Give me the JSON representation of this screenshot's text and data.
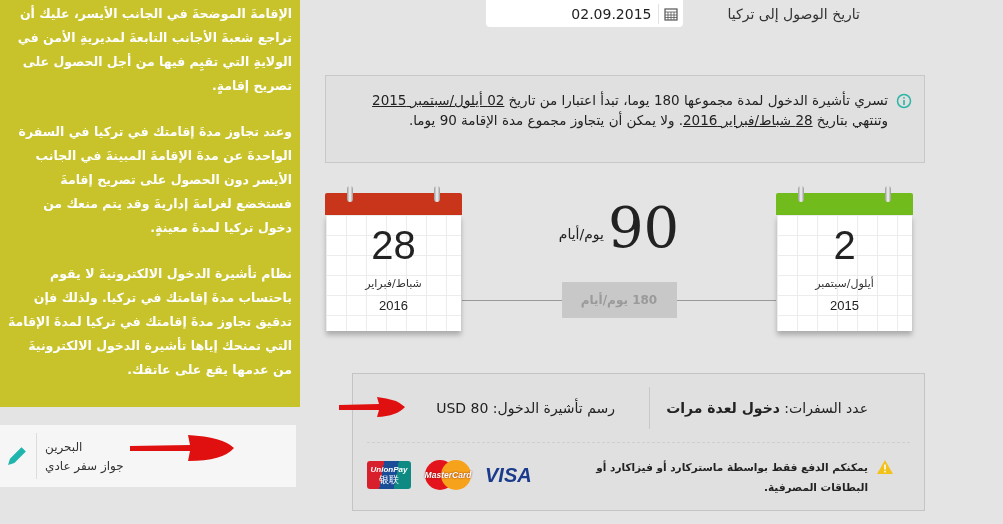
{
  "sidebar": {
    "paragraphs": [
      "الإقامةَ الموضحةَ في الجانب الأيسر، عليك أن تراجع شعبةَ الأجانب التابعةَ لمديريةِ الأمن في الولايةِ التي تقيِم فيها من أجل الحصول على تصريح إقامةٍ.",
      "وعند تجاوز مدةَ إقامتك في تركيا في السفرة الواحدةَ عن مدةَ الإقامةَ المبينةَ في الجانب الأيسر دون الحصول على تصريح إقامةَ فستخضع لغرامةَ إداريةَ وقد يتم منعك من دخول تركيا لمدةَ معينةٍ.",
      "نظام تأشيرة الدخول الالكترونيةَ لا يقوم باحتساب مدةَ إقامتك في تركيا. ولذلك فإن تدقيق تجاوز مدةَ إقامتك في تركيا لمدةَ الإقامةَ التي تمنحك إياها تأشيرة الدخول الالكترونيةَ من عدمها يقع على عاتقك."
    ]
  },
  "passport": {
    "country": "البحرين",
    "type": "جواز سفر عادي"
  },
  "arrival": {
    "label": "تاريخ الوصول إلى تركيا",
    "value": "02.09.2015"
  },
  "validity_notice": {
    "before": "تسري تأشيرة الدخول لمدة مجموعها 180 يوما، تبدأ اعتبارا من تاريخ",
    "start_date": "02 أيلول/سبتمبر 2015",
    "middle": "وتنتهي بتاريخ",
    "end_date": "28 شباط/فبراير 2016",
    "after": ". ولا يمكن أن يتجاوز مجموع مدة الإقامة 90 يوما."
  },
  "calendars": [
    {
      "day": "2",
      "month": "أيلول/سبتمبر",
      "year": "2015",
      "color": "#72bb1c"
    },
    {
      "day": "28",
      "month": "شباط/فبراير",
      "year": "2016",
      "color": "#c9351a"
    }
  ],
  "stay": {
    "days": "90",
    "unit": "يوم/أيام",
    "validity": "180 يوم/أيام"
  },
  "visa_details": {
    "entries": "عدد السفرات: **دخول لعدة مرات**",
    "fee": "رسم تأشيرة الدخول: USD 80"
  },
  "payment": {
    "notice": "يمكنكم الدفع فقط بواسطة ماستركارد أو فيزاكارد أو البطاقات المصرفية.",
    "cards": [
      {
        "kind": "visa",
        "label": "VISA"
      },
      {
        "kind": "mastercard",
        "label": "MasterCard"
      },
      {
        "kind": "unionpay",
        "label": "UnionPay",
        "sublabel": "银联"
      }
    ]
  }
}
